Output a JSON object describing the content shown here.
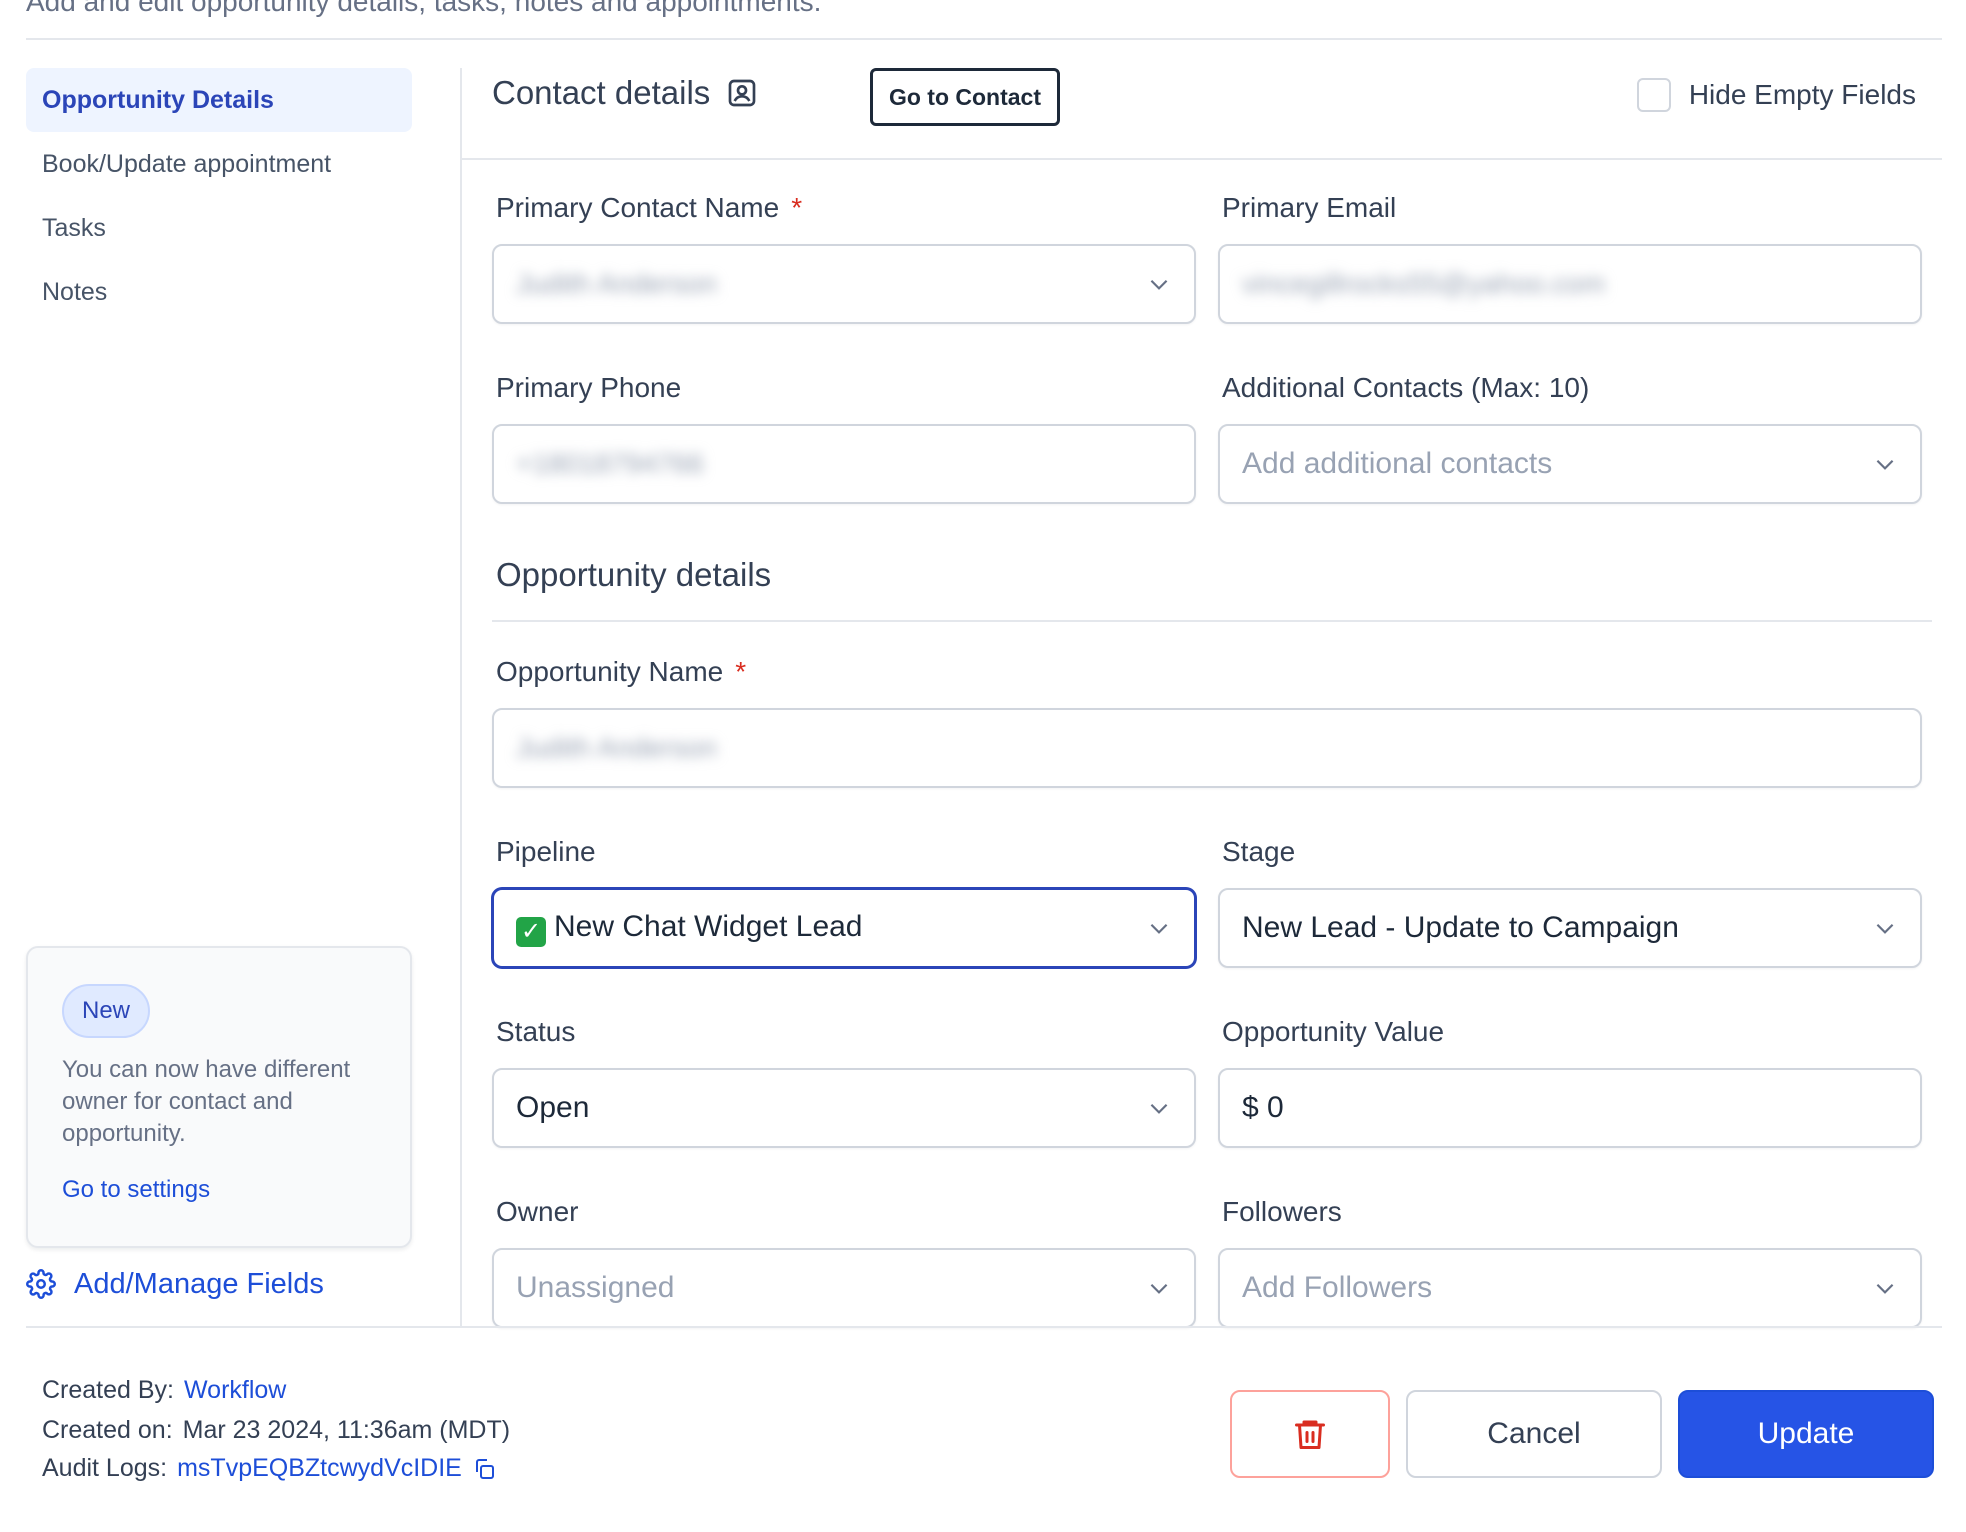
{
  "page": {
    "subtitle": "Add and edit opportunity details, tasks, notes and appointments."
  },
  "sidebar": {
    "items": [
      {
        "label": "Opportunity Details"
      },
      {
        "label": "Book/Update appointment"
      },
      {
        "label": "Tasks"
      },
      {
        "label": "Notes"
      }
    ],
    "promo": {
      "badge": "New",
      "text": "You can now have different owner for contact and opportunity.",
      "link": "Go to settings"
    },
    "manage_fields": "Add/Manage Fields"
  },
  "header": {
    "title": "Contact details",
    "goto_contact": "Go to Contact",
    "hide_empty": "Hide Empty Fields"
  },
  "contact": {
    "primary_name": {
      "label": "Primary Contact Name",
      "required": "*",
      "value": "Judith Anderson"
    },
    "primary_email": {
      "label": "Primary Email",
      "value": "vincegillrocks55@yahoo.com"
    },
    "primary_phone": {
      "label": "Primary Phone",
      "value": "+18018794766"
    },
    "additional": {
      "label": "Additional Contacts (Max: 10)",
      "placeholder": "Add additional contacts"
    }
  },
  "opportunity": {
    "section_title": "Opportunity details",
    "name": {
      "label": "Opportunity Name",
      "required": "*",
      "value": "Judith Anderson"
    },
    "pipeline": {
      "label": "Pipeline",
      "emoji": "✓",
      "value": "New Chat Widget Lead"
    },
    "stage": {
      "label": "Stage",
      "value": "New Lead - Update to Campaign"
    },
    "status": {
      "label": "Status",
      "value": "Open"
    },
    "value": {
      "label": "Opportunity Value",
      "value": "$ 0"
    },
    "owner": {
      "label": "Owner",
      "placeholder": "Unassigned"
    },
    "followers": {
      "label": "Followers",
      "placeholder": "Add Followers"
    }
  },
  "footer": {
    "created_by_label": "Created By:",
    "created_by": "Workflow",
    "created_on_label": "Created on:",
    "created_on": "Mar 23 2024, 11:36am (MDT)",
    "audit_label": "Audit Logs:",
    "audit_id": "msTvpEQBZtcwydVcIDIE",
    "cancel": "Cancel",
    "update": "Update"
  },
  "colors": {
    "accent": "#2654e6",
    "link": "#1d4ed8",
    "danger": "#d92d20",
    "active_bg": "#eef4ff"
  }
}
